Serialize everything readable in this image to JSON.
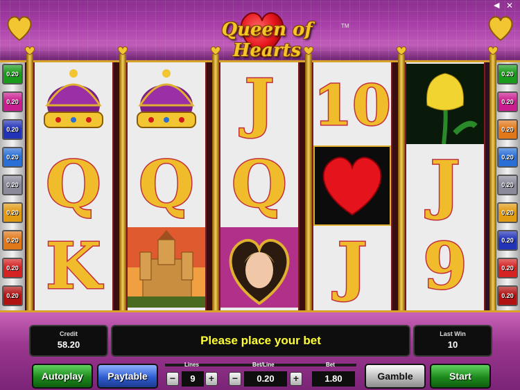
{
  "game": {
    "title": "Queen of Hearts",
    "trademark": "TM"
  },
  "paylines": {
    "left": [
      {
        "label": "0.20",
        "color": "#1a9a1a"
      },
      {
        "label": "0.20",
        "color": "#c81d8e"
      },
      {
        "label": "0.20",
        "color": "#2233b8"
      },
      {
        "label": "0.20",
        "color": "#2a6fd6"
      },
      {
        "label": "0.20",
        "color": "#8a8a9a"
      },
      {
        "label": "0.20",
        "color": "#e09a12"
      },
      {
        "label": "0.20",
        "color": "#e0781a"
      },
      {
        "label": "0.20",
        "color": "#d42222"
      },
      {
        "label": "0.20",
        "color": "#b01212"
      }
    ],
    "right": [
      {
        "label": "0.20",
        "color": "#1a9a1a"
      },
      {
        "label": "0.20",
        "color": "#c81d8e"
      },
      {
        "label": "0.20",
        "color": "#e0781a"
      },
      {
        "label": "0.20",
        "color": "#2a6fd6"
      },
      {
        "label": "0.20",
        "color": "#8a8a9a"
      },
      {
        "label": "0.20",
        "color": "#e09a12"
      },
      {
        "label": "0.20",
        "color": "#2233b8"
      },
      {
        "label": "0.20",
        "color": "#d42222"
      },
      {
        "label": "0.20",
        "color": "#b01212"
      }
    ]
  },
  "reels": [
    [
      "crown",
      "Q",
      "K"
    ],
    [
      "crown",
      "Q",
      "castle"
    ],
    [
      "J",
      "Q",
      "queen"
    ],
    [
      "10",
      "heart",
      "J"
    ],
    [
      "tulip",
      "J",
      "9"
    ]
  ],
  "panel": {
    "credit_label": "Credit",
    "credit_value": "58.20",
    "message": "Please place your bet",
    "last_win_label": "Last Win",
    "last_win_value": "10",
    "autoplay_label": "Autoplay",
    "paytable_label": "Paytable",
    "lines_label": "Lines",
    "lines_value": "9",
    "betline_label": "Bet/Line",
    "betline_value": "0.20",
    "bet_label": "Bet",
    "bet_value": "1.80",
    "gamble_label": "Gamble",
    "start_label": "Start",
    "minus": "−",
    "plus": "+"
  },
  "colors": {
    "gold": "#f4c62a",
    "heart_red": "#e5141c",
    "message_yellow": "#ffff33"
  }
}
